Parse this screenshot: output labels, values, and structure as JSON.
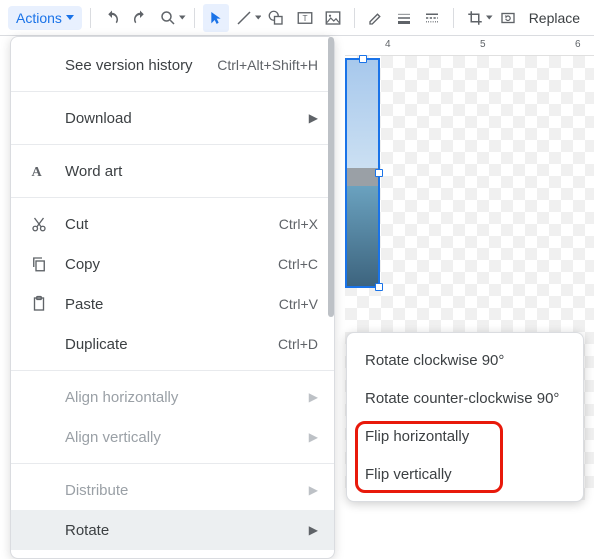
{
  "toolbar": {
    "actions_label": "Actions",
    "replace_label": "Replace"
  },
  "ruler": {
    "marks": [
      "4",
      "5",
      "6"
    ]
  },
  "menu": {
    "version_history": {
      "label": "See version history",
      "shortcut": "Ctrl+Alt+Shift+H"
    },
    "download": {
      "label": "Download"
    },
    "word_art": {
      "label": "Word art"
    },
    "cut": {
      "label": "Cut",
      "shortcut": "Ctrl+X"
    },
    "copy": {
      "label": "Copy",
      "shortcut": "Ctrl+C"
    },
    "paste": {
      "label": "Paste",
      "shortcut": "Ctrl+V"
    },
    "duplicate": {
      "label": "Duplicate",
      "shortcut": "Ctrl+D"
    },
    "align_h": {
      "label": "Align horizontally"
    },
    "align_v": {
      "label": "Align vertically"
    },
    "distribute": {
      "label": "Distribute"
    },
    "rotate": {
      "label": "Rotate"
    }
  },
  "submenu": {
    "rotate_cw": "Rotate clockwise 90°",
    "rotate_ccw": "Rotate counter-clockwise 90°",
    "flip_h": "Flip horizontally",
    "flip_v": "Flip vertically"
  }
}
